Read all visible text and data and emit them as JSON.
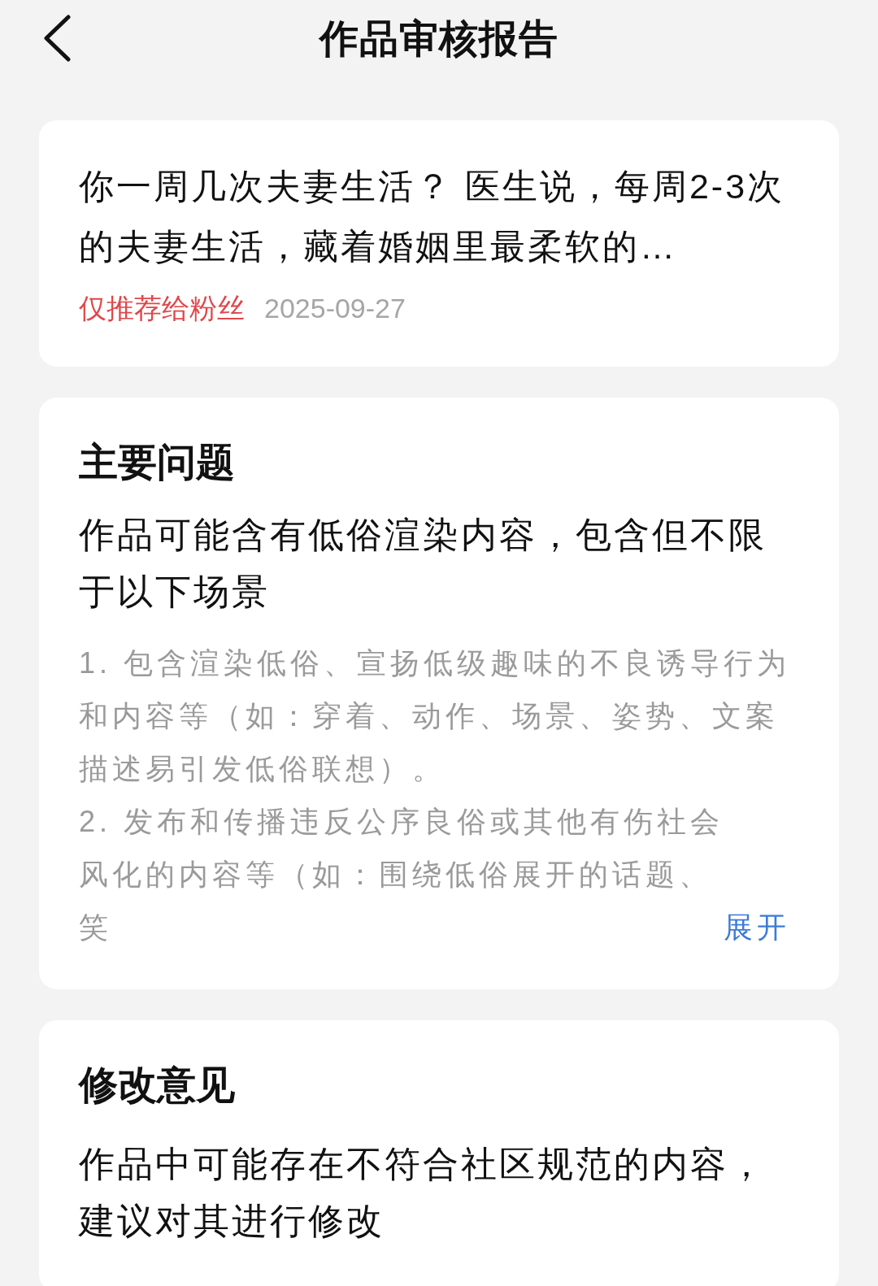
{
  "header": {
    "title": "作品审核报告"
  },
  "work": {
    "title": "你一周几次夫妻生活？ 医生说，每周2-3次的夫妻生活，藏着婚姻里最柔软的…",
    "tag": "仅推荐给粉丝",
    "date": "2025-09-27"
  },
  "main_issue": {
    "heading": "主要问题",
    "summary": "作品可能含有低俗渲染内容，包含但不限于以下场景",
    "details": [
      "1. 包含渲染低俗、宣扬低级趣味的不良诱导行为和内容等（如：穿着、动作、场景、姿势、文案描述易引发低俗联想）。",
      "2. 发布和传播违反公序良俗或其他有伤社会风化的内容等（如：围绕低俗展开的话题、笑"
    ],
    "expand_link": "展开"
  },
  "suggestion": {
    "heading": "修改意见",
    "text": "作品中可能存在不符合社区规范的内容，建议对其进行修改"
  }
}
